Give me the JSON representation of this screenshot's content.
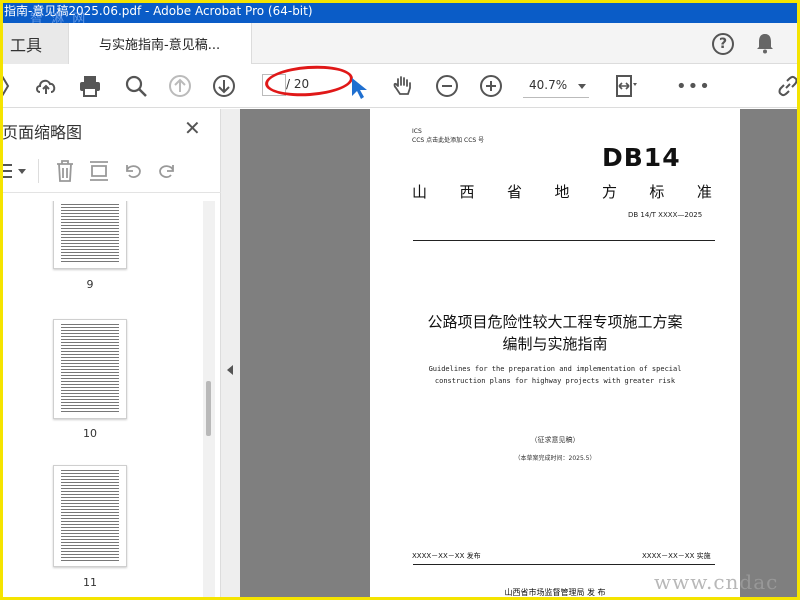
{
  "window": {
    "title": "指南-意见稿2025.06.pdf - Adobe Acrobat Pro (64-bit)",
    "watermark_top": "智 淋 网"
  },
  "tabs": {
    "tools_label": "工具",
    "document_label": "与实施指南-意见稿..."
  },
  "toolbar": {
    "page_current": "",
    "page_total": "/ 20",
    "zoom": "40.7%",
    "more": "•••"
  },
  "sidebar": {
    "title": "页面缩略图",
    "close": "✕",
    "thumbnails": [
      {
        "label": "9"
      },
      {
        "label": "10"
      },
      {
        "label": "11"
      }
    ]
  },
  "document": {
    "ics": "ICS",
    "ccs": "CCS  点击此处添加 CCS 号",
    "db_code": "DB14",
    "standard_chars": [
      "山",
      "西",
      "省",
      "地",
      "方",
      "标",
      "准"
    ],
    "std_number": "DB 14/T XXXX—2025",
    "title_line1": "公路项目危险性较大工程专项施工方案",
    "title_line2": "编制与实施指南",
    "english_line1": "Guidelines for the preparation and implementation of special",
    "english_line2": "construction plans for highway projects with greater risk",
    "draft_note": "（征求意见稿）",
    "draft_date": "（本草案完成时间：2025.5）",
    "publish": "XXXX－XX－XX 发布",
    "implement": "XXXX－XX－XX 实施",
    "issuer": "山西省市场监督管理局   发 布"
  },
  "watermark_bottom": "www.cndac"
}
